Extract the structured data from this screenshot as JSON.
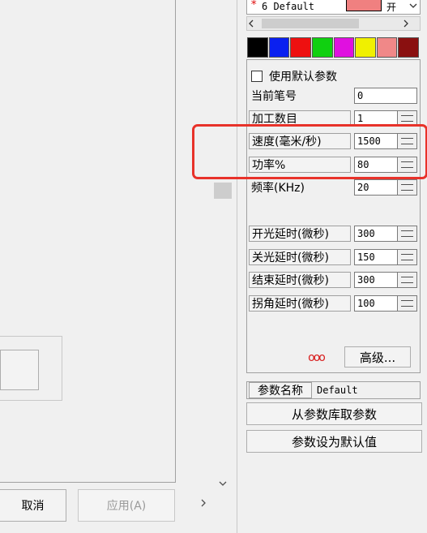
{
  "layer": {
    "marker": "*",
    "name": "6 Default",
    "color": "#f08080",
    "onoff_label": "开"
  },
  "palette": [
    "#000000",
    "#0a20f0",
    "#ee1010",
    "#10d010",
    "#e010e0",
    "#f0f000",
    "#f08888",
    "#8a1010"
  ],
  "use_default": {
    "label": "使用默认参数",
    "checked": false
  },
  "params": {
    "pen_no": {
      "label": "当前笔号",
      "value": "0"
    },
    "process_count": {
      "label": "加工数目",
      "value": "1"
    },
    "speed": {
      "label": "速度(毫米/秒)",
      "value": "1500"
    },
    "power": {
      "label": "功率%",
      "value": "80"
    },
    "frequency": {
      "label": "频率(KHz)",
      "value": "20"
    },
    "laser_on_delay": {
      "label": "开光延时(微秒)",
      "value": "300"
    },
    "laser_off_delay": {
      "label": "关光延时(微秒)",
      "value": "150"
    },
    "end_delay": {
      "label": "结束延时(微秒)",
      "value": "300"
    },
    "corner_delay": {
      "label": "拐角延时(微秒)",
      "value": "100"
    }
  },
  "advanced": {
    "icon_text": "ooo",
    "label": "高级..."
  },
  "param_name": {
    "label": "参数名称",
    "value": "Default"
  },
  "buttons": {
    "load_from_lib": "从参数库取参数",
    "set_default": "参数设为默认值",
    "cancel": "取消",
    "apply": "应用(A)"
  },
  "highlight_color": "#e8322a",
  "icons": {
    "scroll_left": "<",
    "scroll_right": ">",
    "scroll_down": "v",
    "dropdown": "v"
  }
}
